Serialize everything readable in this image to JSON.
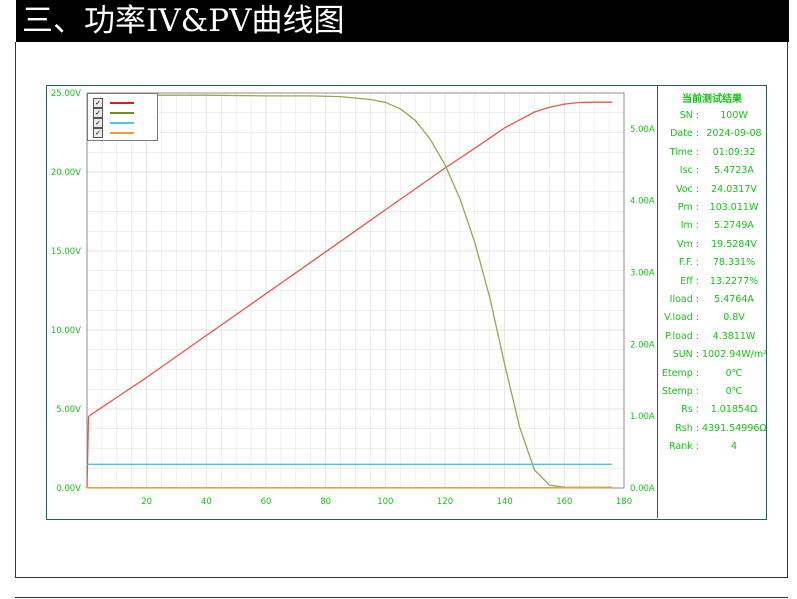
{
  "page": {
    "heading": "三、功率IV&PV曲线图"
  },
  "results_panel": {
    "header": "当前测试结果",
    "rows": [
      {
        "label": "SN :",
        "value": "100W"
      },
      {
        "label": "Date :",
        "value": "2024-09-08"
      },
      {
        "label": "Time :",
        "value": "01:09:32"
      },
      {
        "label": "Isc :",
        "value": "5.4723A"
      },
      {
        "label": "Voc :",
        "value": "24.0317V"
      },
      {
        "label": "Pm :",
        "value": "103.011W"
      },
      {
        "label": "Im :",
        "value": "5.2749A"
      },
      {
        "label": "Vm :",
        "value": "19.5284V"
      },
      {
        "label": "F.F. :",
        "value": "78.331%"
      },
      {
        "label": "Eff :",
        "value": "13.2277%"
      },
      {
        "label": "Iload :",
        "value": "5.4764A"
      },
      {
        "label": "V.load :",
        "value": "0.8V"
      },
      {
        "label": "P.load :",
        "value": "4.3811W"
      },
      {
        "label": "SUN :",
        "value": "1002.94W/m²"
      },
      {
        "label": "Etemp :",
        "value": "0℃"
      },
      {
        "label": "Stemp :",
        "value": "0℃"
      },
      {
        "label": "Rs :",
        "value": "1.01854Ω"
      },
      {
        "label": "Rsh :",
        "value": "4391.54996Ω"
      },
      {
        "label": "Rank :",
        "value": "4"
      }
    ]
  },
  "colors": {
    "axis_text": "#14c414",
    "frame": "#2e5d5d",
    "grid": "#e2e2e2"
  },
  "chart_data": {
    "type": "line",
    "title": "",
    "xlabel": "",
    "ylabel": "",
    "xlim": [
      0,
      180
    ],
    "ylim": [
      0,
      25
    ],
    "y2lim": [
      0,
      5.5
    ],
    "grid": true,
    "legend": "top-left",
    "x_ticks": [
      20,
      40,
      60,
      80,
      100,
      120,
      140,
      160,
      180
    ],
    "y_ticks": [
      0,
      5,
      10,
      15,
      20,
      25
    ],
    "y_tick_labels": [
      "0.00V",
      "5.00V",
      "10.00V",
      "15.00V",
      "20.00V",
      "25.00V"
    ],
    "y2_ticks": [
      0,
      1,
      2,
      3,
      4,
      5
    ],
    "y2_tick_labels": [
      "0.00A",
      "1.00A",
      "2.00A",
      "3.00A",
      "4.00A",
      "5.00A"
    ],
    "series": [
      {
        "color": "#e8554e",
        "axis": "left",
        "x": [
          0,
          0.5,
          1,
          20,
          40,
          60,
          80,
          100,
          120,
          130,
          140,
          145,
          150,
          155,
          160,
          165,
          170,
          176
        ],
        "y": [
          0,
          4.5,
          4.6,
          7.0,
          9.65,
          12.3,
          14.95,
          17.6,
          20.25,
          21.5,
          22.8,
          23.3,
          23.8,
          24.1,
          24.3,
          24.4,
          24.42,
          24.42
        ]
      },
      {
        "color": "#95a84a",
        "axis": "right",
        "x": [
          0,
          20,
          40,
          60,
          75,
          85,
          95,
          100,
          105,
          110,
          115,
          120,
          125,
          130,
          135,
          140,
          145,
          150,
          155,
          160,
          176
        ],
        "y": [
          5.47,
          5.47,
          5.47,
          5.46,
          5.46,
          5.45,
          5.41,
          5.37,
          5.28,
          5.12,
          4.86,
          4.5,
          4.03,
          3.42,
          2.65,
          1.72,
          0.85,
          0.25,
          0.04,
          0.01,
          0.01
        ]
      },
      {
        "color": "#3ecbe0",
        "axis": "left",
        "x": [
          0,
          176
        ],
        "y": [
          1.5,
          1.5
        ]
      },
      {
        "color": "#f59a3c",
        "axis": "left",
        "x": [
          0,
          176
        ],
        "y": [
          0.02,
          0.02
        ]
      }
    ]
  }
}
